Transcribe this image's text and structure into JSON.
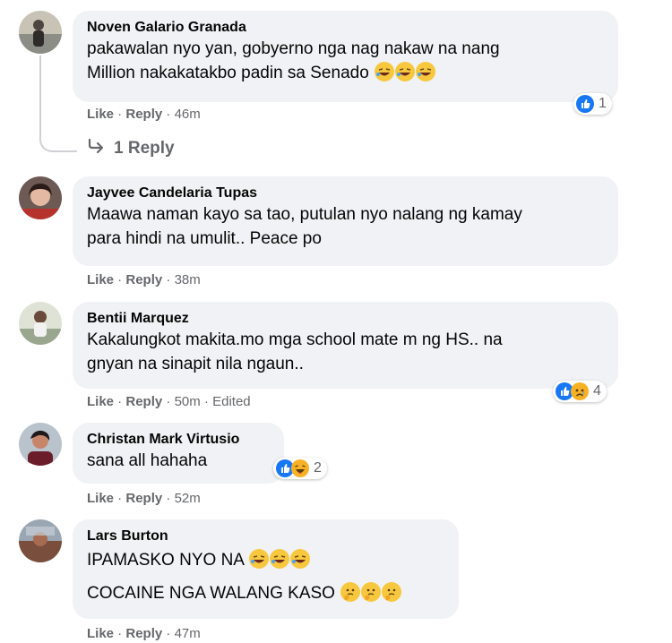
{
  "comments": [
    {
      "author": "Noven Galario Granada",
      "lines": [
        "pakawalan nyo yan, gobyerno nga nag nakaw na nang",
        "Million nakakatakbo padin sa Senado"
      ],
      "emoji": [
        "rofl",
        "rofl",
        "rofl"
      ],
      "actions": {
        "like": "Like",
        "reply": "Reply",
        "time": "46m"
      },
      "reactions": {
        "icons": [
          "like"
        ],
        "count": "1"
      },
      "replies_link": "1 Reply"
    },
    {
      "author": "Jayvee Candelaria Tupas",
      "lines": [
        "Maawa naman kayo sa tao, putulan nyo nalang ng kamay",
        "para hindi na umulit.. Peace po"
      ],
      "actions": {
        "like": "Like",
        "reply": "Reply",
        "time": "38m"
      }
    },
    {
      "author": "Bentii Marquez",
      "lines": [
        "Kakalungkot makita.mo mga school mate m ng HS.. na",
        "gnyan na sinapit nila ngaun.."
      ],
      "actions": {
        "like": "Like",
        "reply": "Reply",
        "time": "50m",
        "edited": "Edited"
      },
      "reactions": {
        "icons": [
          "like",
          "sad"
        ],
        "count": "4"
      }
    },
    {
      "author": "Christan Mark Virtusio",
      "lines": [
        "sana all hahaha"
      ],
      "actions": {
        "like": "Like",
        "reply": "Reply",
        "time": "52m"
      },
      "reactions": {
        "icons": [
          "like",
          "haha"
        ],
        "count": "2"
      }
    },
    {
      "author": "Lars Burton",
      "lines": [
        "IPAMASKO NYO NA",
        "COCAINE NGA WALANG KASO"
      ],
      "emoji_line1": [
        "rofl",
        "rofl",
        "rofl"
      ],
      "emoji_line2": [
        "thinking",
        "thinking",
        "thinking"
      ],
      "actions": {
        "like": "Like",
        "reply": "Reply",
        "time": "47m"
      }
    }
  ],
  "colors": {
    "like_blue": "#1877f2",
    "sad_yellow": "#f7b125",
    "meta_gray": "#65676b",
    "bubble_bg": "#f0f2f5"
  }
}
